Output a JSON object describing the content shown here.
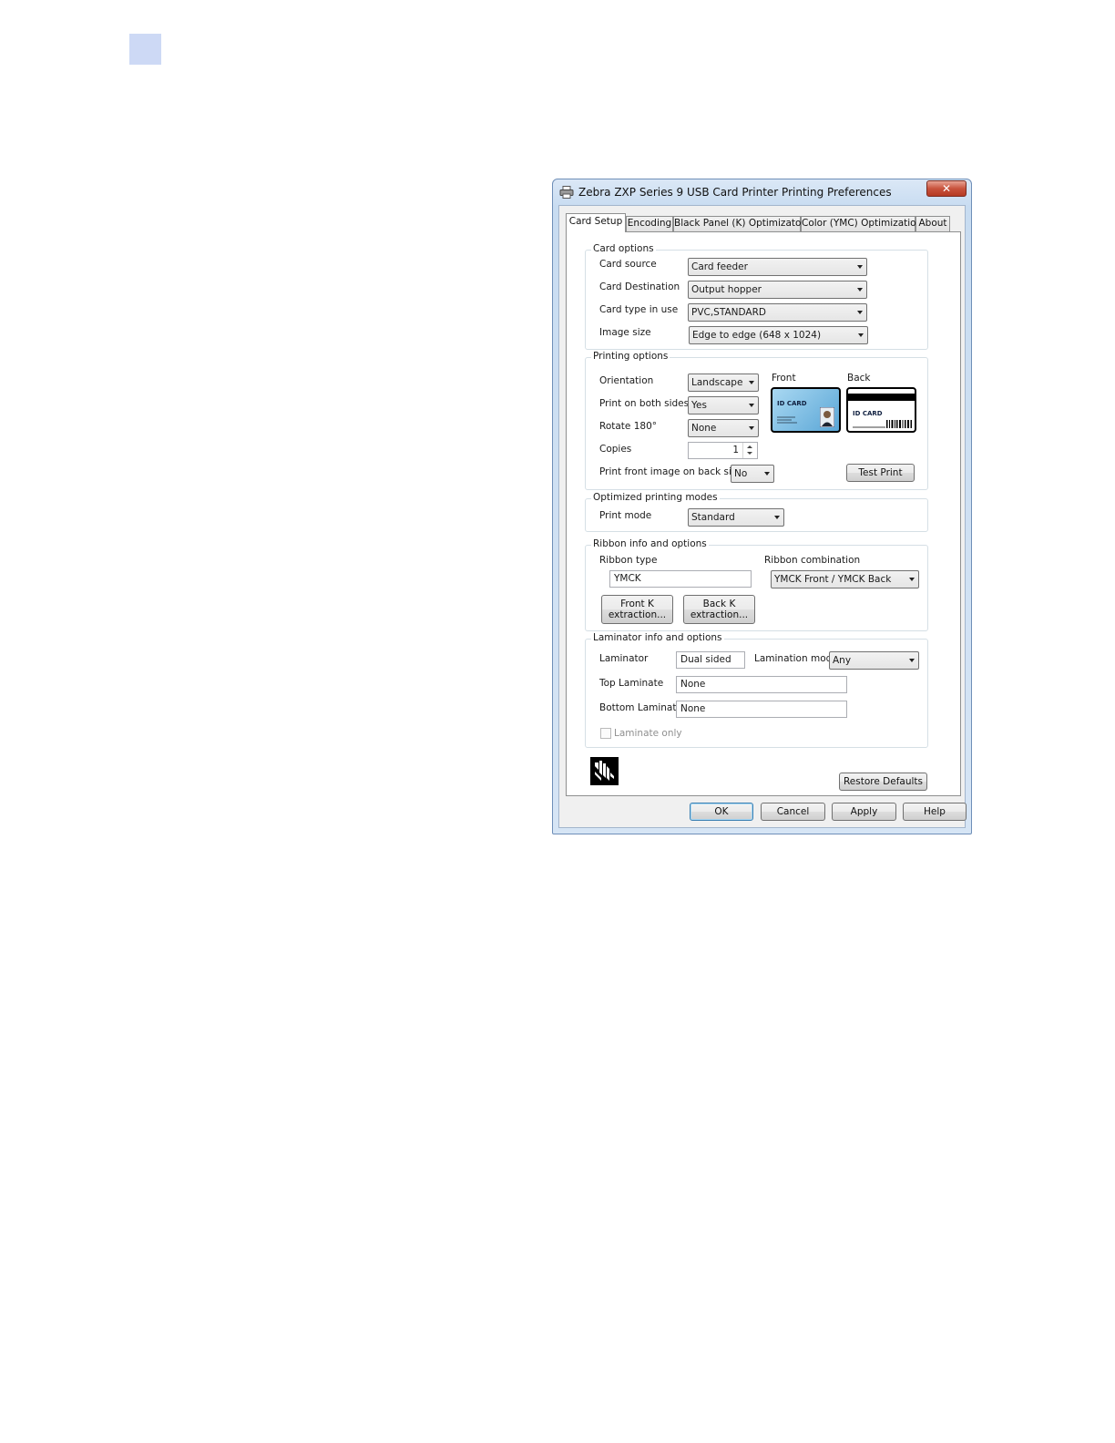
{
  "window": {
    "title": "Zebra ZXP Series 9 USB Card Printer Printing Preferences",
    "close_glyph": "✕"
  },
  "tabs": [
    {
      "label": "Card Setup",
      "active": true
    },
    {
      "label": "Encoding",
      "active": false
    },
    {
      "label": "Black Panel (K) Optimizaton",
      "active": false
    },
    {
      "label": "Color (YMC) Optimization",
      "active": false
    },
    {
      "label": "About",
      "active": false
    }
  ],
  "card_options": {
    "title": "Card options",
    "card_source": {
      "label": "Card source",
      "value": "Card feeder"
    },
    "card_destination": {
      "label": "Card Destination",
      "value": "Output hopper"
    },
    "card_type": {
      "label": "Card type in use",
      "value": "PVC,STANDARD"
    },
    "image_size": {
      "label": "Image size",
      "value": "Edge to edge (648 x 1024)"
    }
  },
  "printing_options": {
    "title": "Printing options",
    "orientation": {
      "label": "Orientation",
      "value": "Landscape"
    },
    "both_sides": {
      "label": "Print on both sides",
      "value": "Yes"
    },
    "rotate": {
      "label": "Rotate 180°",
      "value": "None"
    },
    "copies": {
      "label": "Copies",
      "value": "1"
    },
    "front_on_back": {
      "label": "Print front image on back side",
      "value": "No"
    },
    "front_label": "Front",
    "back_label": "Back",
    "front_card_text": "ID CARD",
    "back_card_text": "ID CARD",
    "test_print": "Test Print"
  },
  "optimized_modes": {
    "title": "Optimized printing modes",
    "print_mode": {
      "label": "Print mode",
      "value": "Standard"
    }
  },
  "ribbon": {
    "title": "Ribbon info and options",
    "type_label": "Ribbon type",
    "type_value": "YMCK",
    "combination_label": "Ribbon combination",
    "combination_value": "YMCK Front / YMCK Back",
    "front_k_line1": "Front K",
    "front_k_line2": "extraction...",
    "back_k_line1": "Back K",
    "back_k_line2": "extraction..."
  },
  "laminator": {
    "title": "Laminator info and options",
    "laminator_label": "Laminator",
    "laminator_value": "Dual sided",
    "mode_label": "Lamination mode",
    "mode_value": "Any",
    "top_label": "Top Laminate",
    "top_value": "None",
    "bottom_label": "Bottom Laminate",
    "bottom_value": "None",
    "laminate_only_label": "Laminate only",
    "laminate_only_checked": false
  },
  "restore_defaults": "Restore Defaults",
  "footer": {
    "ok": "OK",
    "cancel": "Cancel",
    "apply": "Apply",
    "help": "Help"
  },
  "colors": {
    "page_marker": "#cdd9f5",
    "close_button": "#c8533d",
    "front_card": "#6fb3dc"
  }
}
